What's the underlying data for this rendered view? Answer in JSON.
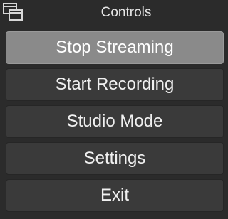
{
  "dock": {
    "title": "Controls",
    "float_icon": "undock-window-icon"
  },
  "buttons": [
    {
      "label": "Stop Streaming",
      "active": true
    },
    {
      "label": "Start Recording",
      "active": false
    },
    {
      "label": "Studio Mode",
      "active": false
    },
    {
      "label": "Settings",
      "active": false
    },
    {
      "label": "Exit",
      "active": false
    }
  ],
  "colors": {
    "background": "#2b2b2b",
    "button": "#3a3a3a",
    "button_active": "#8a8a8a",
    "text": "#f0f0f0"
  }
}
